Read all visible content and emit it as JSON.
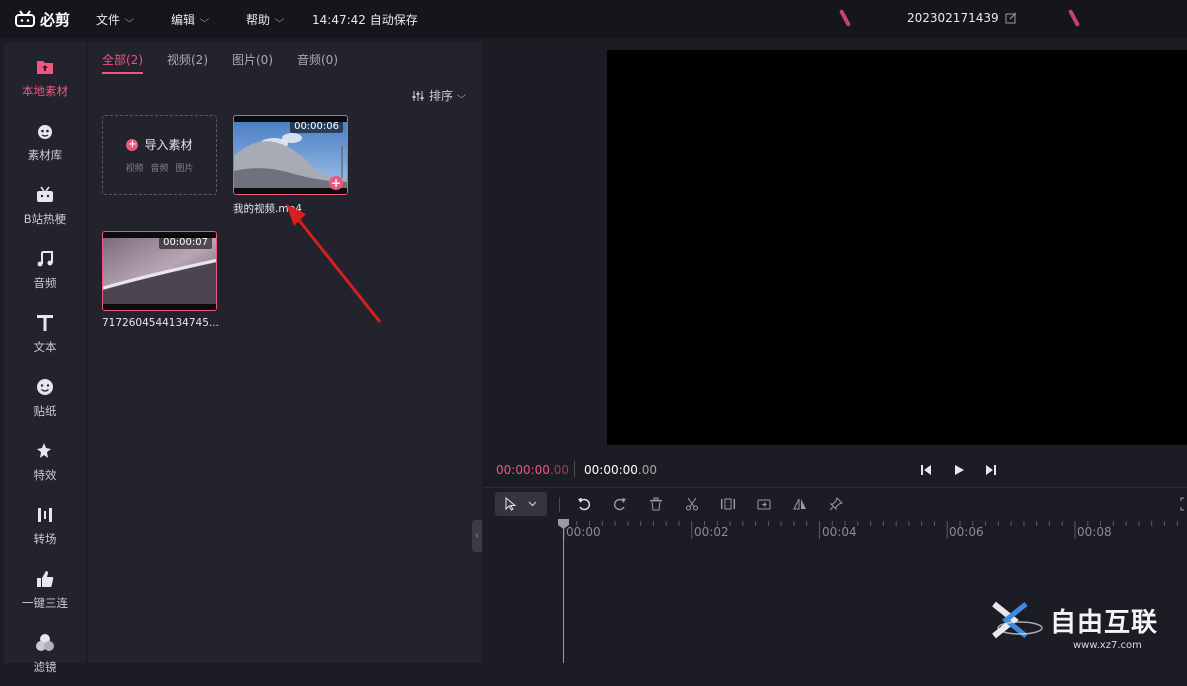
{
  "app": {
    "name": "必剪"
  },
  "menu": {
    "file": "文件",
    "edit": "编辑",
    "help": "帮助",
    "autosave": "14:47:42 自动保存",
    "project_name": "202302171439"
  },
  "sidebar": {
    "items": [
      {
        "label": "本地素材",
        "icon": "folder-upload-icon"
      },
      {
        "label": "素材库",
        "icon": "mascot-icon"
      },
      {
        "label": "B站热梗",
        "icon": "tv-icon"
      },
      {
        "label": "音频",
        "icon": "music-note-icon"
      },
      {
        "label": "文本",
        "icon": "text-icon"
      },
      {
        "label": "贴纸",
        "icon": "sticker-icon"
      },
      {
        "label": "特效",
        "icon": "sparkle-icon"
      },
      {
        "label": "转场",
        "icon": "transition-icon"
      },
      {
        "label": "一键三连",
        "icon": "thumbs-up-icon"
      },
      {
        "label": "滤镜",
        "icon": "filter-icon"
      }
    ],
    "active_color": "#f0557f"
  },
  "assets": {
    "tabs": [
      {
        "label": "全部(2)"
      },
      {
        "label": "视频(2)"
      },
      {
        "label": "图片(0)"
      },
      {
        "label": "音频(0)"
      }
    ],
    "sort_label": "排序",
    "import": {
      "title": "导入素材",
      "sub": [
        "视频",
        "音频",
        "图片"
      ]
    },
    "media": [
      {
        "duration": "00:00:06",
        "filename": "我的视频.mp4"
      },
      {
        "duration": "00:00:07",
        "filename": "7172604544134745..."
      }
    ]
  },
  "preview": {
    "current_time": "00:00:00",
    "current_ms": ".00",
    "total_time": "00:00:00",
    "total_ms": ".00"
  },
  "timeline": {
    "ticks": [
      "00:00",
      "00:02",
      "00:04",
      "00:06",
      "00:08"
    ]
  },
  "watermark": {
    "text": "自由互联",
    "site": "www.xz7.com"
  },
  "colors": {
    "accent": "#f0557f",
    "background": "#1b1c24",
    "panel": "#22232c"
  }
}
